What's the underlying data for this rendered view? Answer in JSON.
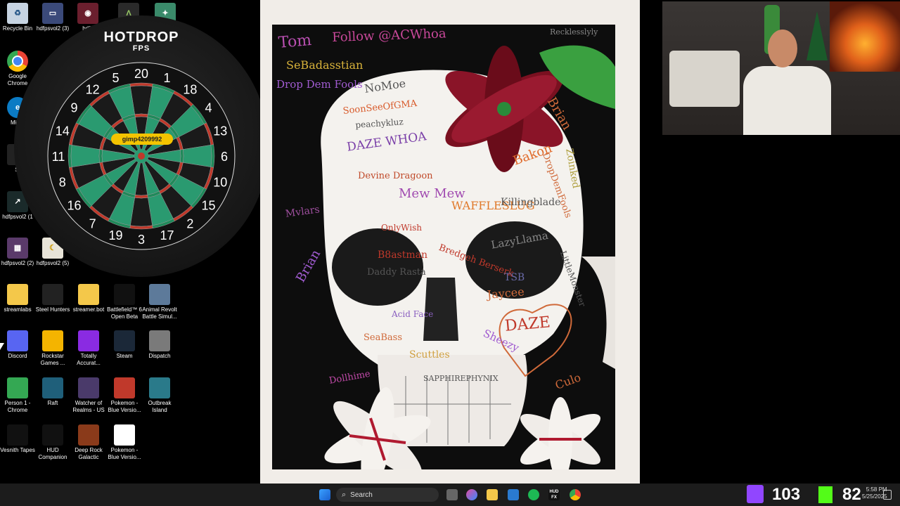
{
  "desktop": {
    "icons_top": [
      {
        "label": "Recycle Bin",
        "icon": "recycle-bin-icon",
        "color": "#c7d4e2"
      },
      {
        "label": "hdfpsvol2 (3)",
        "icon": "monitor-icon",
        "color": "#3b4a7a"
      },
      {
        "label": "hdfp",
        "icon": "game-icon",
        "color": "#6b1f2e"
      },
      {
        "label": "",
        "icon": "game-icon",
        "color": "#333"
      },
      {
        "label": "",
        "icon": "game-icon",
        "color": "#333"
      }
    ],
    "icons_left": [
      {
        "label": "Google Chrome",
        "icon": "chrome-icon"
      },
      {
        "label": "Mic E",
        "icon": "edge-icon"
      },
      {
        "label": "St",
        "icon": "shortcut-icon"
      },
      {
        "label": "hdfpsvol2 (1",
        "icon": "shortcut-icon"
      },
      {
        "label": "hdfpsvol2 (2)",
        "icon": "image-icon"
      },
      {
        "label": "hdfpsvol2 (5)",
        "icon": "image-icon"
      }
    ],
    "grid": [
      {
        "label": "streamlabs",
        "icon": "folder-icon",
        "color": "#f4c84a"
      },
      {
        "label": "Steel Hunters",
        "icon": "steel-hunters-icon",
        "color": "#222"
      },
      {
        "label": "streamer.bot",
        "icon": "folder-icon",
        "color": "#f4c84a"
      },
      {
        "label": "Battlefield™ 6 Open Beta",
        "icon": "battlefield-icon",
        "color": "#111"
      },
      {
        "label": "Animal Revolt Battle Simul...",
        "icon": "game-icon",
        "color": "#5d7a9a"
      },
      {
        "label": "Discord",
        "icon": "discord-icon",
        "color": "#5865f2"
      },
      {
        "label": "Rockstar Games ...",
        "icon": "rockstar-icon",
        "color": "#f4b400"
      },
      {
        "label": "Totally Accurat...",
        "icon": "game-icon",
        "color": "#8a2be2"
      },
      {
        "label": "Steam",
        "icon": "steam-icon",
        "color": "#1b2838"
      },
      {
        "label": "Dispatch",
        "icon": "game-icon",
        "color": "#7a7a7a"
      },
      {
        "label": "Person 1 - Chrome",
        "icon": "chrome-icon",
        "color": "#34a853"
      },
      {
        "label": "Raft",
        "icon": "raft-icon",
        "color": "#1f5f7a"
      },
      {
        "label": "Watcher of Realms - US",
        "icon": "game-icon",
        "color": "#4a3a6a"
      },
      {
        "label": "Pokemon - Blue Versio...",
        "icon": "pokemon-icon",
        "color": "#c0392b"
      },
      {
        "label": "Outbreak Island",
        "icon": "game-icon",
        "color": "#2a7a8a"
      },
      {
        "label": "Vesnith Tapes",
        "icon": "game-icon",
        "color": "#111"
      },
      {
        "label": "HUD Companion",
        "icon": "hud-fx-icon",
        "color": "#111"
      },
      {
        "label": "Deep Rock Galactic",
        "icon": "game-icon",
        "color": "#8a3a1a"
      },
      {
        "label": "Pokemon - Blue Versio...",
        "icon": "file-icon",
        "color": "#fff"
      }
    ]
  },
  "dart_widget": {
    "title": "HOTDROP",
    "subtitle": "FPS",
    "player_tag": "gimp4209992",
    "numbers": [
      "20",
      "1",
      "18",
      "4",
      "13",
      "6",
      "10",
      "15",
      "2",
      "17",
      "3",
      "19",
      "7",
      "16",
      "8",
      "11",
      "14",
      "9",
      "12",
      "5"
    ]
  },
  "painting": {
    "scribbles": [
      {
        "text": "Tom",
        "color": "#b84fb0",
        "size": 22
      },
      {
        "text": "Follow @ACWhoa",
        "color": "#c9489a",
        "size": 18
      },
      {
        "text": "SeBadasstian",
        "color": "#d8b23a",
        "size": 16
      },
      {
        "text": "Drop Dem Fools",
        "color": "#a05bd0",
        "size": 15
      },
      {
        "text": "NoMoe",
        "color": "#555",
        "size": 16
      },
      {
        "text": "SoonSeeOfGMA",
        "color": "#d85a2a",
        "size": 13
      },
      {
        "text": "peachykluz",
        "color": "#555",
        "size": 12
      },
      {
        "text": "DAZE WHOA",
        "color": "#7a3fa8",
        "size": 17
      },
      {
        "text": "Devine Dragoon",
        "color": "#c04a2a",
        "size": 13
      },
      {
        "text": "Mew Mew",
        "color": "#a04ab0",
        "size": 18
      },
      {
        "text": "WAFFLESLUG",
        "color": "#e0792a",
        "size": 16
      },
      {
        "text": "Killingblade",
        "color": "#555",
        "size": 14
      },
      {
        "text": "OnlyWish",
        "color": "#c0392b",
        "size": 12
      },
      {
        "text": "Bakon",
        "color": "#e06a2a",
        "size": 18
      },
      {
        "text": "Brian",
        "color": "#d06a3a",
        "size": 18
      },
      {
        "text": "Zoinked",
        "color": "#b0a040",
        "size": 14
      },
      {
        "text": "DropDemFools",
        "color": "#d06a3a",
        "size": 13
      },
      {
        "text": "Mvlars",
        "color": "#a050a0",
        "size": 14
      },
      {
        "text": "Brian",
        "color": "#a05bd0",
        "size": 18
      },
      {
        "text": "B8astman",
        "color": "#c0392b",
        "size": 14
      },
      {
        "text": "Daddy Rasta",
        "color": "#555",
        "size": 13
      },
      {
        "text": "Bredgeh Berserk",
        "color": "#c0392b",
        "size": 13
      },
      {
        "text": "LazyLlama",
        "color": "#888",
        "size": 15
      },
      {
        "text": "TSB",
        "color": "#6a6aa8",
        "size": 14
      },
      {
        "text": "Jaycee",
        "color": "#d06a3a",
        "size": 16
      },
      {
        "text": "Acid Face",
        "color": "#8a5fc0",
        "size": 12
      },
      {
        "text": "DAZE",
        "color": "#c0392b",
        "size": 22
      },
      {
        "text": "SeaBass",
        "color": "#d06a3a",
        "size": 13
      },
      {
        "text": "Scuttles",
        "color": "#d0a040",
        "size": 14
      },
      {
        "text": "Sheezy",
        "color": "#a05bd0",
        "size": 15
      },
      {
        "text": "SAPPHIREPHYNIX",
        "color": "#555",
        "size": 11
      },
      {
        "text": "Dollhime",
        "color": "#c04aa8",
        "size": 13
      },
      {
        "text": "Culo",
        "color": "#d06a3a",
        "size": 16
      },
      {
        "text": "LittleMonster",
        "color": "#555",
        "size": 12
      },
      {
        "text": "Recklesslyly",
        "color": "#888",
        "size": 11
      }
    ]
  },
  "taskbar": {
    "search_placeholder": "Search",
    "time": "5:58 PM",
    "date": "5/25/2025",
    "overlay_num1": "103",
    "overlay_num2": "82",
    "colors": {
      "twitch": "#9146ff",
      "kick": "#53fc18"
    }
  }
}
